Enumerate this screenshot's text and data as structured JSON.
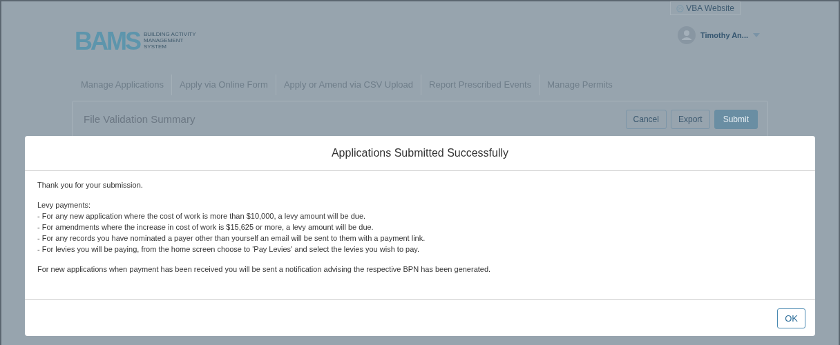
{
  "header": {
    "website_link": "VBA Website",
    "logo": {
      "mark": "BAMS",
      "caption": [
        "BUILDING ACTIVITY",
        "MANAGEMENT",
        "SYSTEM"
      ]
    },
    "user": {
      "name": "Timothy An..."
    }
  },
  "nav": [
    "Manage Applications",
    "Apply via Online Form",
    "Apply or Amend via CSV Upload",
    "Report Prescribed Events",
    "Manage Permits"
  ],
  "card": {
    "title": "File Validation Summary",
    "buttons": [
      {
        "label": "Cancel",
        "kind": "outline"
      },
      {
        "label": "Export",
        "kind": "outline"
      },
      {
        "label": "Submit",
        "kind": "primary"
      }
    ]
  },
  "dialog": {
    "title": "Applications Submitted Successfully",
    "paragraphs": [
      [
        "Thank you for your submission."
      ],
      [
        "Levy payments:",
        "- For any new application where the cost of work is more than $10,000, a levy amount will be due.",
        "- For amendments where the increase in cost of work is $15,625 or more, a levy amount will be due.",
        "- For any records you have nominated a payer other than yourself an email will be sent to them with a payment link.",
        "- For levies you will be paying, from the home screen choose to 'Pay Levies' and select the levies you wish to pay."
      ],
      [
        "For new applications when payment has been received you will be sent a notification advising the respective BPN has been generated."
      ]
    ],
    "button": "OK"
  }
}
